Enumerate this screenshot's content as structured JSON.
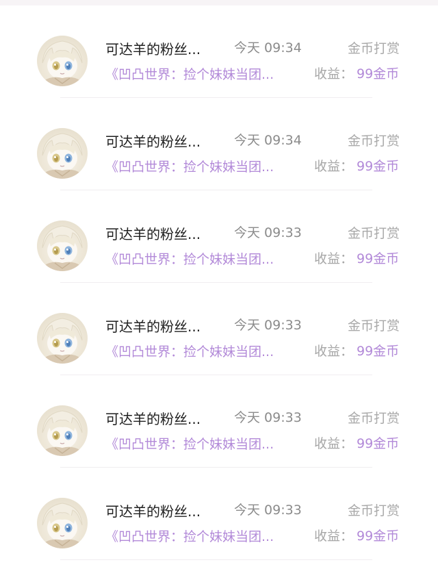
{
  "items": [
    {
      "name": "可达羊的粉丝...",
      "time": "今天 09:34",
      "type": "金币打赏",
      "book": "《凹凸世界：捡个妹妹当团...",
      "earn_label": "收益：",
      "earn_value": "99金币"
    },
    {
      "name": "可达羊的粉丝...",
      "time": "今天 09:34",
      "type": "金币打赏",
      "book": "《凹凸世界：捡个妹妹当团...",
      "earn_label": "收益：",
      "earn_value": "99金币"
    },
    {
      "name": "可达羊的粉丝...",
      "time": "今天 09:33",
      "type": "金币打赏",
      "book": "《凹凸世界：捡个妹妹当团...",
      "earn_label": "收益：",
      "earn_value": "99金币"
    },
    {
      "name": "可达羊的粉丝...",
      "time": "今天 09:33",
      "type": "金币打赏",
      "book": "《凹凸世界：捡个妹妹当团...",
      "earn_label": "收益：",
      "earn_value": "99金币"
    },
    {
      "name": "可达羊的粉丝...",
      "time": "今天 09:33",
      "type": "金币打赏",
      "book": "《凹凸世界：捡个妹妹当团...",
      "earn_label": "收益：",
      "earn_value": "99金币"
    },
    {
      "name": "可达羊的粉丝...",
      "time": "今天 09:33",
      "type": "金币打赏",
      "book": "《凹凸世界：捡个妹妹当团...",
      "earn_label": "收益：",
      "earn_value": "99金币"
    }
  ],
  "colors": {
    "accent": "#b289d8",
    "name": "#1e1e1e",
    "muted": "#a6a6a6"
  },
  "icons": {
    "avatar": "anime-avatar-icon"
  }
}
